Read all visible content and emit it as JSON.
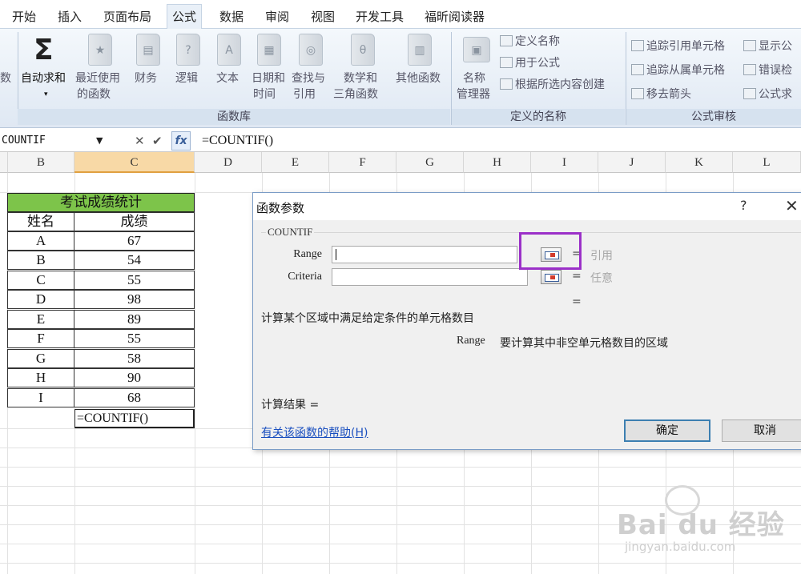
{
  "ribbon_tabs": [
    "开始",
    "插入",
    "页面布局",
    "公式",
    "数据",
    "审阅",
    "视图",
    "开发工具",
    "福昕阅读器"
  ],
  "ribbon": {
    "left_cut_label": "数",
    "autosum": {
      "line1": "自动求和",
      "line2": "▾"
    },
    "recent": {
      "line1": "最近使用",
      "line2": "的函数"
    },
    "finance": {
      "line1": "财务"
    },
    "logic": {
      "line1": "逻辑"
    },
    "text": {
      "line1": "文本"
    },
    "datetime": {
      "line1": "日期和",
      "line2": "时间"
    },
    "lookup": {
      "line1": "查找与",
      "line2": "引用"
    },
    "math": {
      "line1": "数学和",
      "line2": "三角函数"
    },
    "other": {
      "line1": "其他函数"
    },
    "library_label": "函数库",
    "name_manager": {
      "line1": "名称",
      "line2": "管理器"
    },
    "define_name": "定义名称",
    "use_in_formula": "用于公式",
    "create_from_selection": "根据所选内容创建",
    "defined_names_label": "定义的名称",
    "trace_precedents": "追踪引用单元格",
    "trace_dependents": "追踪从属单元格",
    "remove_arrows": "移去箭头",
    "show_formulas": "显示公",
    "error_checking": "错误检",
    "evaluate_formula": "公式求",
    "auditing_label": "公式审核"
  },
  "formula_bar": {
    "name_box": "COUNTIF",
    "cancel_symbol": "✕",
    "enter_symbol": "✔",
    "fx_symbol": "fx",
    "formula": "=COUNTIF()"
  },
  "columns": [
    "B",
    "C",
    "D",
    "E",
    "F",
    "G",
    "H",
    "I",
    "J",
    "K",
    "L"
  ],
  "table": {
    "title": "考试成绩统计",
    "headers": [
      "姓名",
      "成绩"
    ],
    "rows": [
      [
        "A",
        "67"
      ],
      [
        "B",
        "54"
      ],
      [
        "C",
        "55"
      ],
      [
        "D",
        "98"
      ],
      [
        "E",
        "89"
      ],
      [
        "F",
        "55"
      ],
      [
        "G",
        "58"
      ],
      [
        "H",
        "90"
      ],
      [
        "I",
        "68"
      ]
    ],
    "formula_cell": "=COUNTIF()"
  },
  "dialog": {
    "title": "函数参数",
    "help_symbol": "?",
    "close_symbol": "✕",
    "function_name": "COUNTIF",
    "args": [
      {
        "label": "Range",
        "value": "",
        "hint": "引用"
      },
      {
        "label": "Criteria",
        "value": "",
        "hint": "任意"
      }
    ],
    "equals": "=",
    "description": "计算某个区域中满足给定条件的单元格数目",
    "param_name": "Range",
    "param_description": "要计算其中非空单元格数目的区域",
    "result_label": "计算结果 =",
    "help_link": "有关该函数的帮助(H)",
    "ok": "确定",
    "cancel": "取消"
  },
  "watermark": {
    "main": "Bai du 经验",
    "sub": "jingyan.baidu.com"
  },
  "colors": {
    "highlight": "#9b30c8",
    "table_title_bg": "#7dc44a",
    "selected_col": "#f8d9a6",
    "link": "#1a4fbf"
  }
}
